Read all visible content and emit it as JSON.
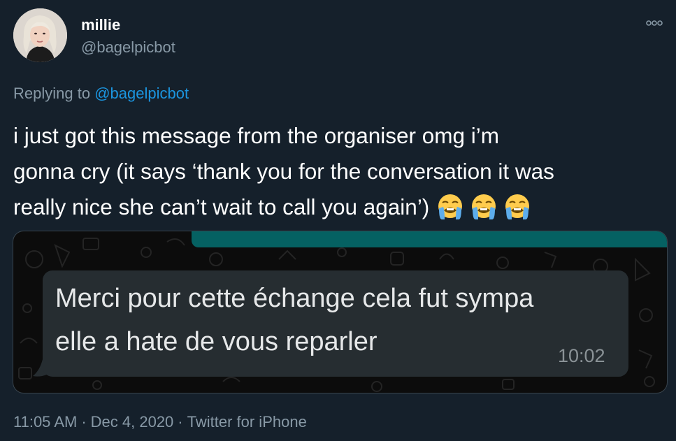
{
  "author": {
    "display_name": "millie",
    "handle": "@bagelpicbot"
  },
  "reply": {
    "prefix": "Replying to ",
    "mention": "@bagelpicbot"
  },
  "tweet": {
    "lines": [
      "i just got this message from the organiser omg i’m",
      "gonna cry (it says ‘thank you for the conversation it was",
      "really nice she can’t wait to call you again’)"
    ],
    "emojis": [
      "loudly-crying-face-icon",
      "loudly-crying-face-icon",
      "loudly-crying-face-icon"
    ]
  },
  "media": {
    "message_lines": [
      "Merci pour cette échange cela fut sympa",
      "elle a hate de vous reparler"
    ],
    "message_time": "10:02"
  },
  "footer": {
    "time": "11:05 AM",
    "separator": "·",
    "date": "Dec 4, 2020",
    "source": "Twitter for iPhone"
  },
  "colors": {
    "background": "#15202b",
    "secondary_text": "#8899a6",
    "link": "#1b95e0",
    "whatsapp_teal": "#056162",
    "bubble": "#262d31"
  }
}
